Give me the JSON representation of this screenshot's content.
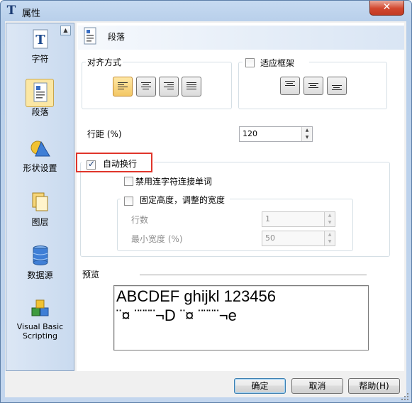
{
  "window": {
    "title": "属性",
    "close_label": "✕"
  },
  "sidebar": {
    "items": [
      {
        "label": "字符",
        "icon": "character-icon"
      },
      {
        "label": "段落",
        "icon": "paragraph-icon"
      },
      {
        "label": "形状设置",
        "icon": "shape-settings-icon"
      },
      {
        "label": "图层",
        "icon": "layer-icon"
      },
      {
        "label": "数据源",
        "icon": "datasource-icon"
      },
      {
        "label_line1": "Visual Basic",
        "label_line2": "Scripting",
        "icon": "vbscript-icon"
      }
    ],
    "scroll_up_glyph": "▲"
  },
  "panel": {
    "title": "段落"
  },
  "alignment": {
    "group_label": "对齐方式",
    "selected": "left"
  },
  "fit_frame": {
    "label": "适应框架",
    "checked": false
  },
  "line_spacing": {
    "label": "行距 (%)",
    "value": "120"
  },
  "word_wrap": {
    "label": "自动换行",
    "checked": true,
    "disable_hyphen_label": "禁用连字符连接单词",
    "disable_hyphen_checked": false,
    "fixed_height_label": "固定高度，调整的宽度",
    "fixed_height_checked": false,
    "rows_label": "行数",
    "rows_value": "1",
    "min_width_label": "最小宽度 (%)",
    "min_width_value": "50"
  },
  "preview": {
    "label": "预览",
    "line1": "ABCDEF ghijkl 123456",
    "line2": "¨¤ ¨¨¨¨¬D ¨¤ ¨¨¨¨¬e"
  },
  "buttons": {
    "ok": "确定",
    "cancel": "取消",
    "help": "帮助(H)"
  },
  "colors": {
    "accent": "#fbe7a4",
    "sidebar": "#c9daef",
    "highlight": "#e0352b"
  }
}
